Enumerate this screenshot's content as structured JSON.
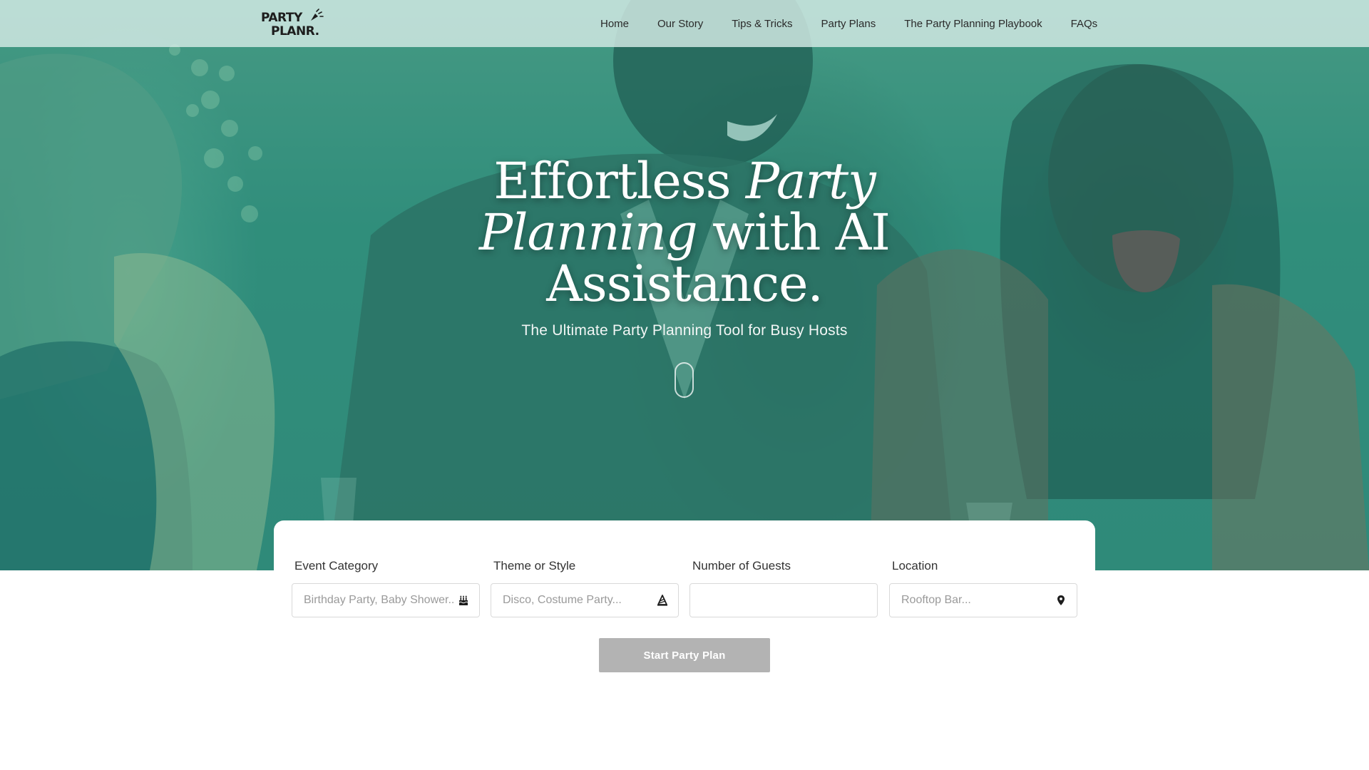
{
  "brand": {
    "logo_line1": "PARTY",
    "logo_line2": "PLANR."
  },
  "nav": {
    "items": [
      {
        "label": "Home"
      },
      {
        "label": "Our Story"
      },
      {
        "label": "Tips & Tricks"
      },
      {
        "label": "Party Plans"
      },
      {
        "label": "The Party Planning Playbook"
      },
      {
        "label": "FAQs"
      }
    ]
  },
  "hero": {
    "headline_part1": "Effortless ",
    "headline_italic": "Party Planning",
    "headline_part2": " with AI Assistance.",
    "subtitle": "The Ultimate Party Planning Tool for Busy Hosts"
  },
  "form": {
    "fields": [
      {
        "label": "Event Category",
        "placeholder": "Birthday Party, Baby Shower...",
        "icon": "cake-icon"
      },
      {
        "label": "Theme or Style",
        "placeholder": "Disco, Costume Party...",
        "icon": "party-hat-icon"
      },
      {
        "label": "Number of Guests",
        "placeholder": "",
        "icon": ""
      },
      {
        "label": "Location",
        "placeholder": "Rooftop Bar...",
        "icon": "map-pin-icon"
      }
    ],
    "submit_label": "Start Party Plan"
  },
  "colors": {
    "hero_tint": "#2f8a79",
    "nav_background": "#d6ece6",
    "button_disabled": "#b3b3b3"
  }
}
